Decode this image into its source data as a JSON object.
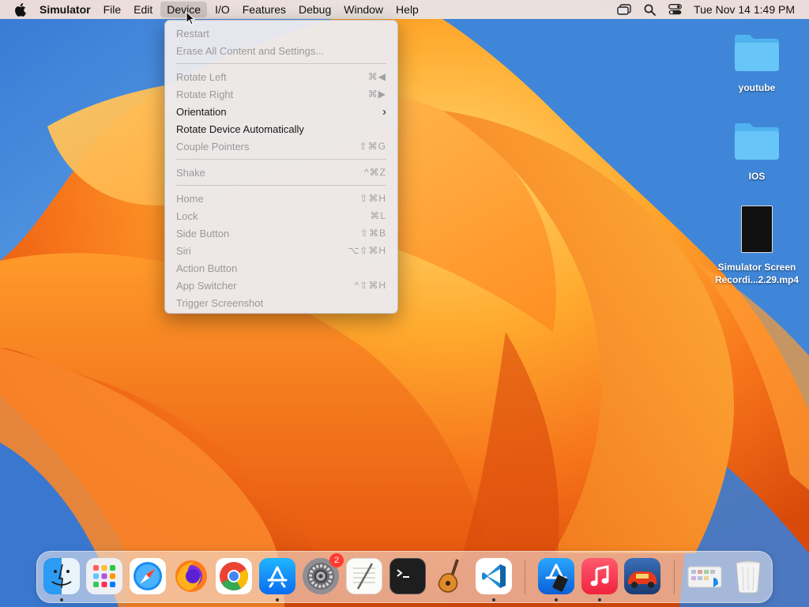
{
  "menubar": {
    "app_name": "Simulator",
    "items": [
      {
        "label": "File"
      },
      {
        "label": "Edit"
      },
      {
        "label": "Device"
      },
      {
        "label": "I/O"
      },
      {
        "label": "Features"
      },
      {
        "label": "Debug"
      },
      {
        "label": "Window"
      },
      {
        "label": "Help"
      }
    ],
    "clock": "Tue Nov 14  1:49 PM"
  },
  "device_menu": {
    "restart": {
      "label": "Restart",
      "shortcut": ""
    },
    "erase": {
      "label": "Erase All Content and Settings...",
      "shortcut": ""
    },
    "rotate_left": {
      "label": "Rotate Left",
      "shortcut": "⌘◀"
    },
    "rotate_right": {
      "label": "Rotate Right",
      "shortcut": "⌘▶"
    },
    "orientation": {
      "label": "Orientation",
      "shortcut": "›"
    },
    "rotate_auto": {
      "label": "Rotate Device Automatically",
      "shortcut": ""
    },
    "couple_pointers": {
      "label": "Couple Pointers",
      "shortcut": "⇧⌘G"
    },
    "shake": {
      "label": "Shake",
      "shortcut": "^⌘Z"
    },
    "home": {
      "label": "Home",
      "shortcut": "⇧⌘H"
    },
    "lock": {
      "label": "Lock",
      "shortcut": "⌘L"
    },
    "side_button": {
      "label": "Side Button",
      "shortcut": "⇧⌘B"
    },
    "siri": {
      "label": "Siri",
      "shortcut": "⌥⇧⌘H"
    },
    "action_button": {
      "label": "Action Button",
      "shortcut": ""
    },
    "app_switcher": {
      "label": "App Switcher",
      "shortcut": "^⇧⌘H"
    },
    "trigger_screenshot": {
      "label": "Trigger Screenshot",
      "shortcut": ""
    }
  },
  "desktop": {
    "folder_youtube": "youtube",
    "folder_ios": "IOS",
    "file_recording_line1": "Simulator Screen",
    "file_recording_line2": "Recordi...2.29.mp4"
  },
  "dock": {
    "settings_badge": "2"
  },
  "colors": {
    "accent": "#0a84ff",
    "folder": "#5ac8fa"
  }
}
